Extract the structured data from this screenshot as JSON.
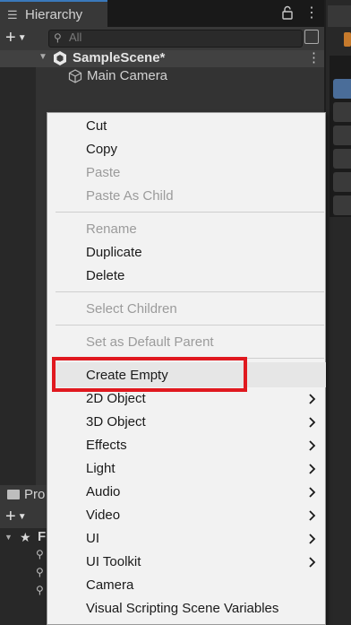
{
  "hierarchy": {
    "tab_label": "Hierarchy",
    "search_placeholder": "All",
    "scene_name": "SampleScene*",
    "objects": [
      "Main Camera"
    ]
  },
  "project": {
    "tab_label": "Pro",
    "folder_letter": "F"
  },
  "context_menu": {
    "groups": [
      [
        {
          "label": "Cut",
          "enabled": true
        },
        {
          "label": "Copy",
          "enabled": true
        },
        {
          "label": "Paste",
          "enabled": false
        },
        {
          "label": "Paste As Child",
          "enabled": false
        }
      ],
      [
        {
          "label": "Rename",
          "enabled": false
        },
        {
          "label": "Duplicate",
          "enabled": true
        },
        {
          "label": "Delete",
          "enabled": true
        }
      ],
      [
        {
          "label": "Select Children",
          "enabled": false
        }
      ],
      [
        {
          "label": "Set as Default Parent",
          "enabled": false
        }
      ],
      [
        {
          "label": "Create Empty",
          "enabled": true,
          "highlighted": true
        },
        {
          "label": "2D Object",
          "enabled": true,
          "submenu": true
        },
        {
          "label": "3D Object",
          "enabled": true,
          "submenu": true
        },
        {
          "label": "Effects",
          "enabled": true,
          "submenu": true
        },
        {
          "label": "Light",
          "enabled": true,
          "submenu": true
        },
        {
          "label": "Audio",
          "enabled": true,
          "submenu": true
        },
        {
          "label": "Video",
          "enabled": true,
          "submenu": true
        },
        {
          "label": "UI",
          "enabled": true,
          "submenu": true
        },
        {
          "label": "UI Toolkit",
          "enabled": true,
          "submenu": true
        },
        {
          "label": "Camera",
          "enabled": true
        },
        {
          "label": "Visual Scripting Scene Variables",
          "enabled": true
        }
      ]
    ]
  },
  "colors": {
    "highlight_box": "#e0191f",
    "tab_accent": "#3a79bb",
    "menu_bg": "#f2f2f2"
  }
}
